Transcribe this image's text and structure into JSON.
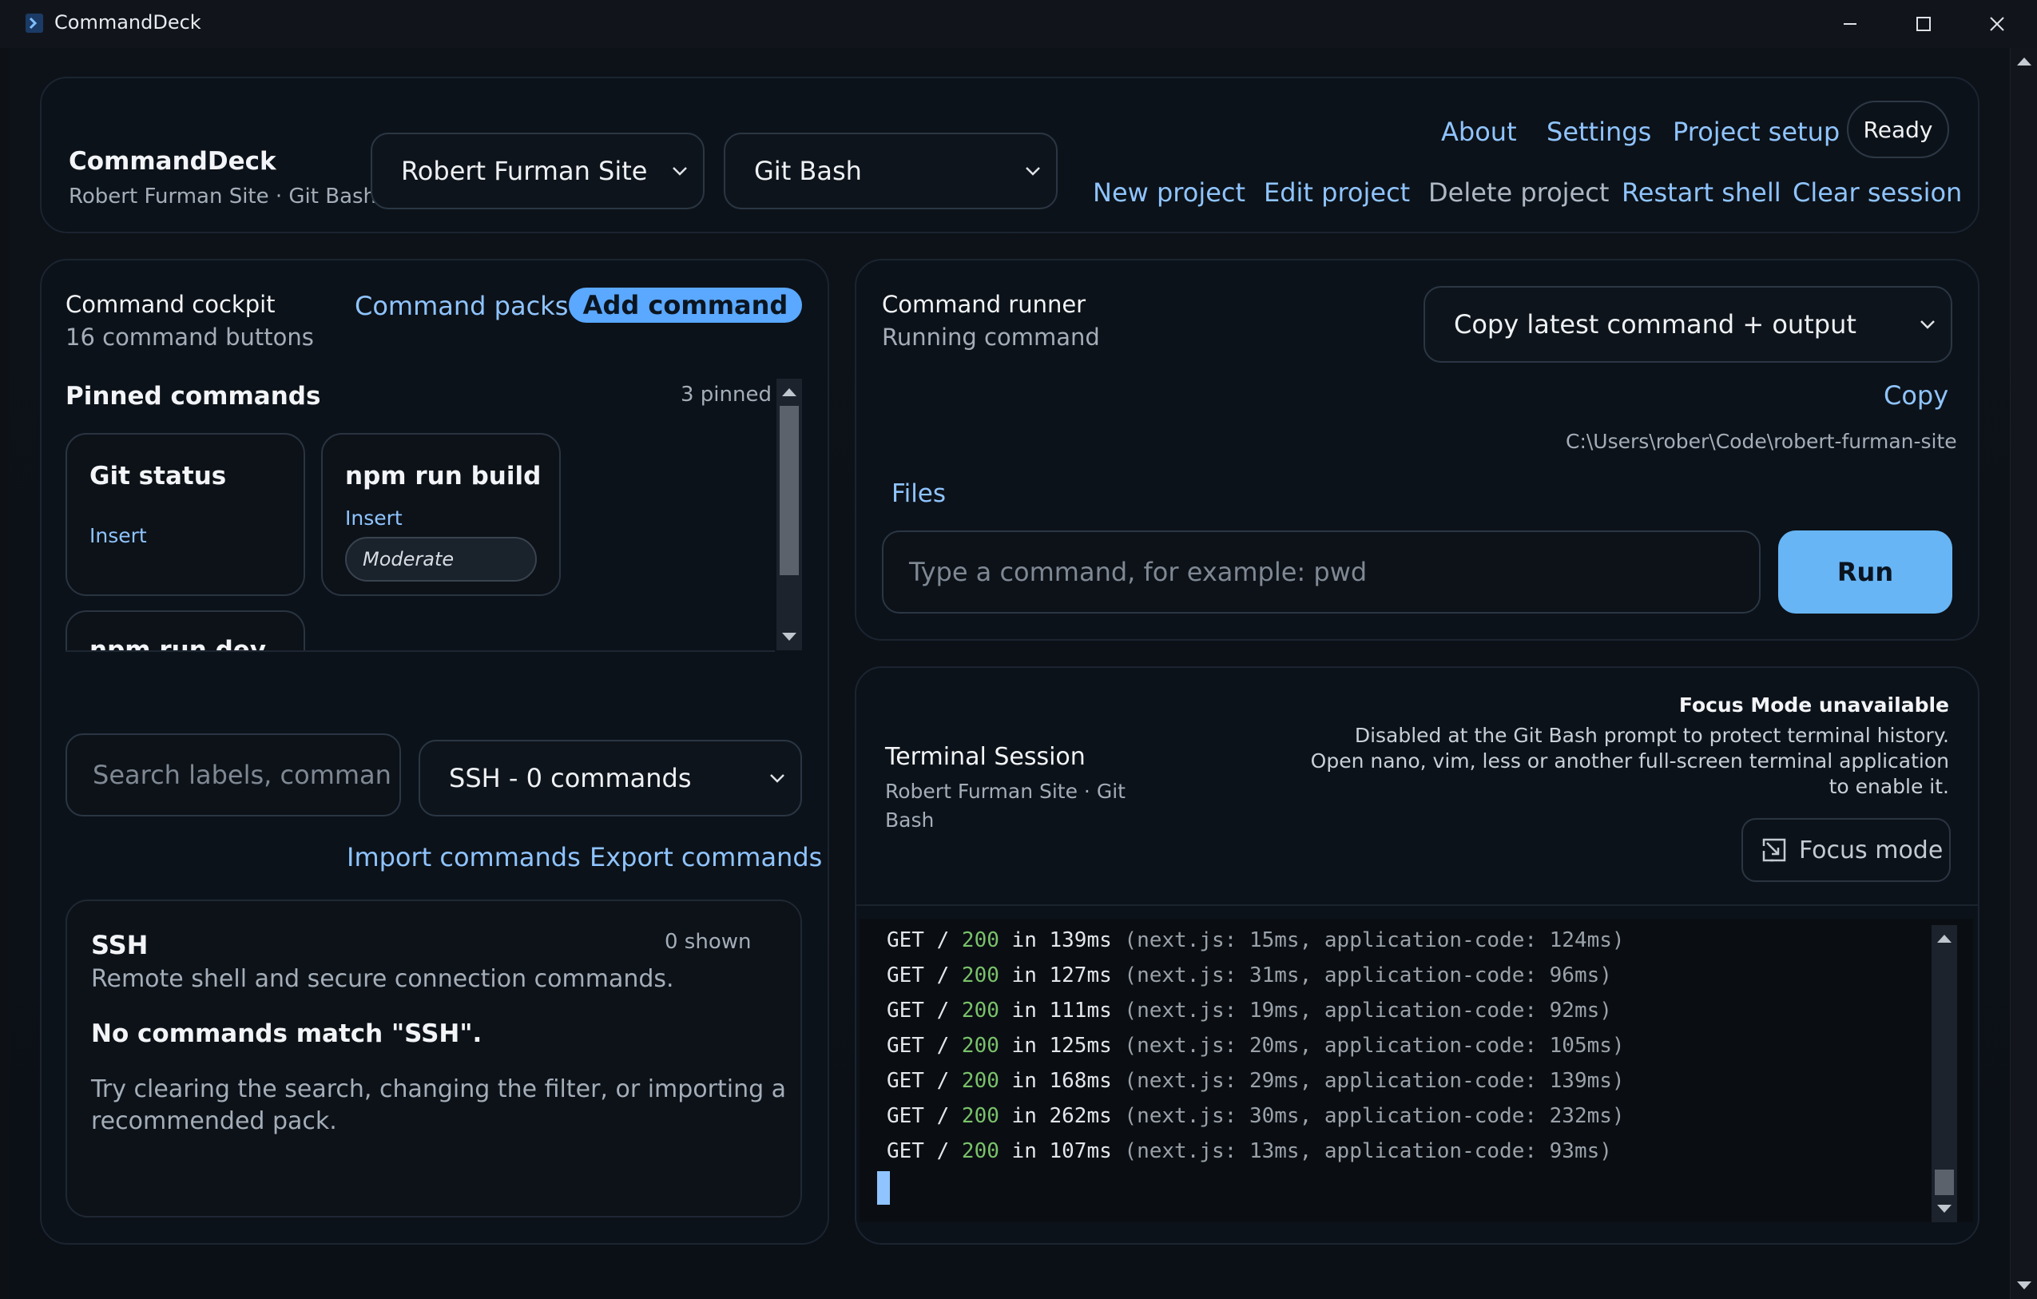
{
  "window": {
    "title": "CommandDeck"
  },
  "header": {
    "app_name": "CommandDeck",
    "subtitle": "Robert Furman Site · Git Bash",
    "project_select": "Robert Furman Site",
    "shell_select": "Git Bash",
    "nav": {
      "about": "About",
      "settings": "Settings",
      "project_setup": "Project setup"
    },
    "status": "Ready",
    "actions": {
      "new_project": "New project",
      "edit_project": "Edit project",
      "delete_project": "Delete project",
      "restart_shell": "Restart shell",
      "clear_session": "Clear session"
    }
  },
  "cockpit": {
    "title": "Command cockpit",
    "count": "16 command buttons",
    "packs_link": "Command packs",
    "add_button": "Add command",
    "pinned_heading": "Pinned commands",
    "pinned_count": "3 pinned",
    "pinned": [
      {
        "name": "Git status",
        "action": "Insert"
      },
      {
        "name": "npm run build",
        "action": "Insert",
        "badge": "Moderate"
      },
      {
        "name": "npm run dev"
      }
    ],
    "search_placeholder": "Search labels, comman",
    "filter_select": "SSH - 0 commands",
    "import_link": "Import commands",
    "export_link": "Export commands",
    "group": {
      "name": "SSH",
      "shown": "0 shown",
      "description": "Remote shell and secure connection commands.",
      "empty_title": "No commands match \"SSH\".",
      "empty_hint_1": "Try clearing the search, changing the filter, or importing a",
      "empty_hint_2": "recommended pack."
    }
  },
  "runner": {
    "title": "Command runner",
    "status": "Running command",
    "copy_select": "Copy latest command + output",
    "copy_button": "Copy",
    "path": "C:\\Users\\rober\\Code\\robert-furman-site",
    "files_link": "Files",
    "command_placeholder": "Type a command, for example: pwd",
    "run_button": "Run"
  },
  "terminal": {
    "title": "Terminal Session",
    "subtitle_1": "Robert Furman Site · Git",
    "subtitle_2": "Bash",
    "focus_title": "Focus Mode unavailable",
    "focus_line_1": "Disabled at the Git Bash prompt to protect terminal history.",
    "focus_line_2": "Open nano, vim, less or another full-screen terminal application",
    "focus_line_3": "to enable it.",
    "focus_button": "Focus mode",
    "lines": [
      {
        "pre": "GET / ",
        "status": "200",
        "mid": " in 139ms",
        "post": " (next.js: 15ms, application-code: 124ms)"
      },
      {
        "pre": "GET / ",
        "status": "200",
        "mid": " in 127ms",
        "post": " (next.js: 31ms, application-code: 96ms)"
      },
      {
        "pre": "GET / ",
        "status": "200",
        "mid": " in 111ms",
        "post": " (next.js: 19ms, application-code: 92ms)"
      },
      {
        "pre": "GET / ",
        "status": "200",
        "mid": " in 125ms",
        "post": " (next.js: 20ms, application-code: 105ms)"
      },
      {
        "pre": "GET / ",
        "status": "200",
        "mid": " in 168ms",
        "post": " (next.js: 29ms, application-code: 139ms)"
      },
      {
        "pre": "GET / ",
        "status": "200",
        "mid": " in 262ms",
        "post": " (next.js: 30ms, application-code: 232ms)"
      },
      {
        "pre": "GET / ",
        "status": "200",
        "mid": " in 107ms",
        "post": " (next.js: 13ms, application-code: 93ms)"
      }
    ]
  },
  "colors": {
    "accent": "#5aa8ff",
    "link": "#8fc4ff",
    "run_button": "#67b5f5",
    "status_ok": "#7ac26a"
  }
}
